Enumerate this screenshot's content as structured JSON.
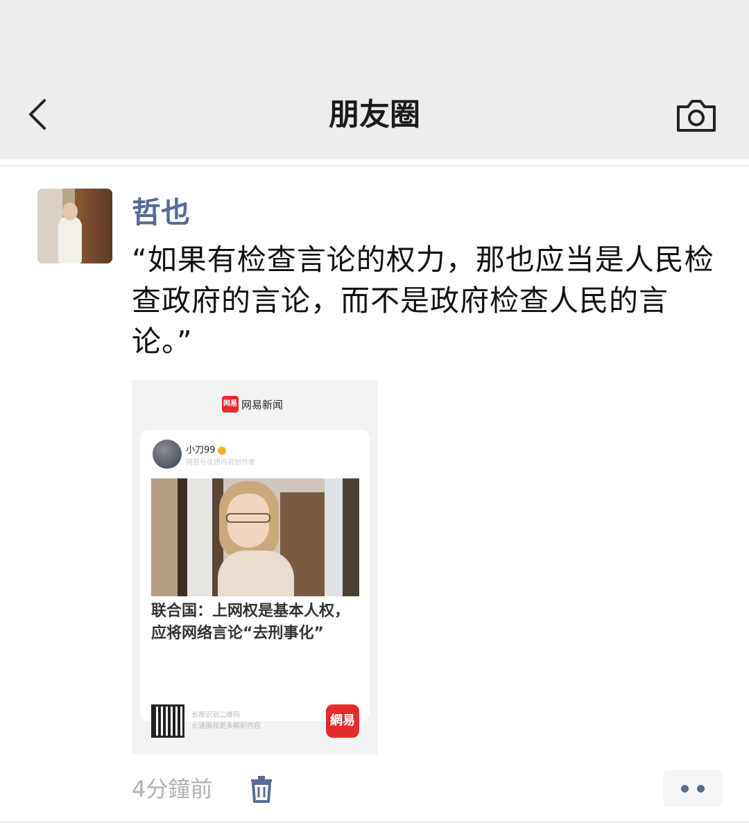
{
  "header": {
    "title": "朋友圈",
    "back_icon": "chevron-left-icon",
    "camera_icon": "camera-icon",
    "background": "#ededed"
  },
  "post": {
    "author": "哲也",
    "text": "“如果有检查言论的权力，那也应当是人民检查政府的言论，而不是政府检查人民的言论。”",
    "time": "4分鐘前",
    "delete_icon": "trash-icon",
    "more_icon": "more-dots-icon",
    "name_color": "#576b95"
  },
  "shared_card": {
    "brand": "网易新闻",
    "brand_logo_text": "网易",
    "author": "小刀99",
    "author_sub": "网易号优质内容创作者",
    "headline": "联合国：上网权是基本人权，应将网络言论“去刑事化”",
    "qr_text_1": "长按识别二维码",
    "qr_text_2": "火速围观更多精彩内容",
    "app_logo_text": "網易",
    "accent": "#e52b2b"
  }
}
